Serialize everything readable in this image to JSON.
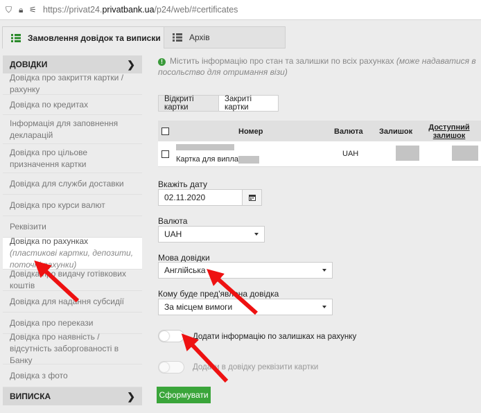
{
  "browser": {
    "url_prefix": "https://privat24.",
    "url_domain": "privatbank.ua",
    "url_path": "/p24/web/#certificates"
  },
  "tabs": [
    {
      "label": "Замовлення довідок та виписки",
      "icon": "list-icon",
      "active": true
    },
    {
      "label": "Архів",
      "icon": "list-icon",
      "active": false
    }
  ],
  "sidebar": {
    "section1": "ДОВІДКИ",
    "items": [
      "Довідка про закриття картки / рахунку",
      "Довідка по кредитах",
      "Інформація для заповнення декларацій",
      "Довідка про цільове призначення картки",
      "Довідка для служби доставки",
      "Довідка про курси валют",
      "Реквізити",
      "Довідка по рахунках",
      "Довідка про видачу готівкових коштів",
      "Довідка для надання субсидії",
      "Довідка про перекази",
      "Довідка про наявність / відсутність заборгованості в Банку",
      "Довідка з фото"
    ],
    "active_item_note": "(пластикові картки, депозити, поточні рахунки)",
    "section2": "ВИПИСКА"
  },
  "info": {
    "text": "Містить інформацію про стан та залишки по всіх рахунках",
    "note": "(може надаватися в посольство для отримання візи)"
  },
  "card_tabs": [
    "Відкриті картки",
    "Закриті картки"
  ],
  "table": {
    "headers": [
      "Номер",
      "Валюта",
      "Залишок",
      "Доступний залишок"
    ],
    "rows": [
      {
        "name": "Картка для виплат",
        "currency": "UAH"
      }
    ]
  },
  "form": {
    "date_label": "Вкажіть дату",
    "date_value": "02.11.2020",
    "currency_label": "Валюта",
    "currency_value": "UAH",
    "lang_label": "Мова довідки",
    "lang_value": "Англійська",
    "recipient_label": "Кому буде пред'явлена довідка",
    "recipient_value": "За місцем вимоги",
    "toggle1_label": "Додати інформацію по залишках на рахунку",
    "toggle2_label": "Додати в довідку реквізити картки",
    "submit_label": "Сформувати"
  },
  "colors": {
    "accent": "#3aa53a",
    "arrow": "#ee1111"
  }
}
